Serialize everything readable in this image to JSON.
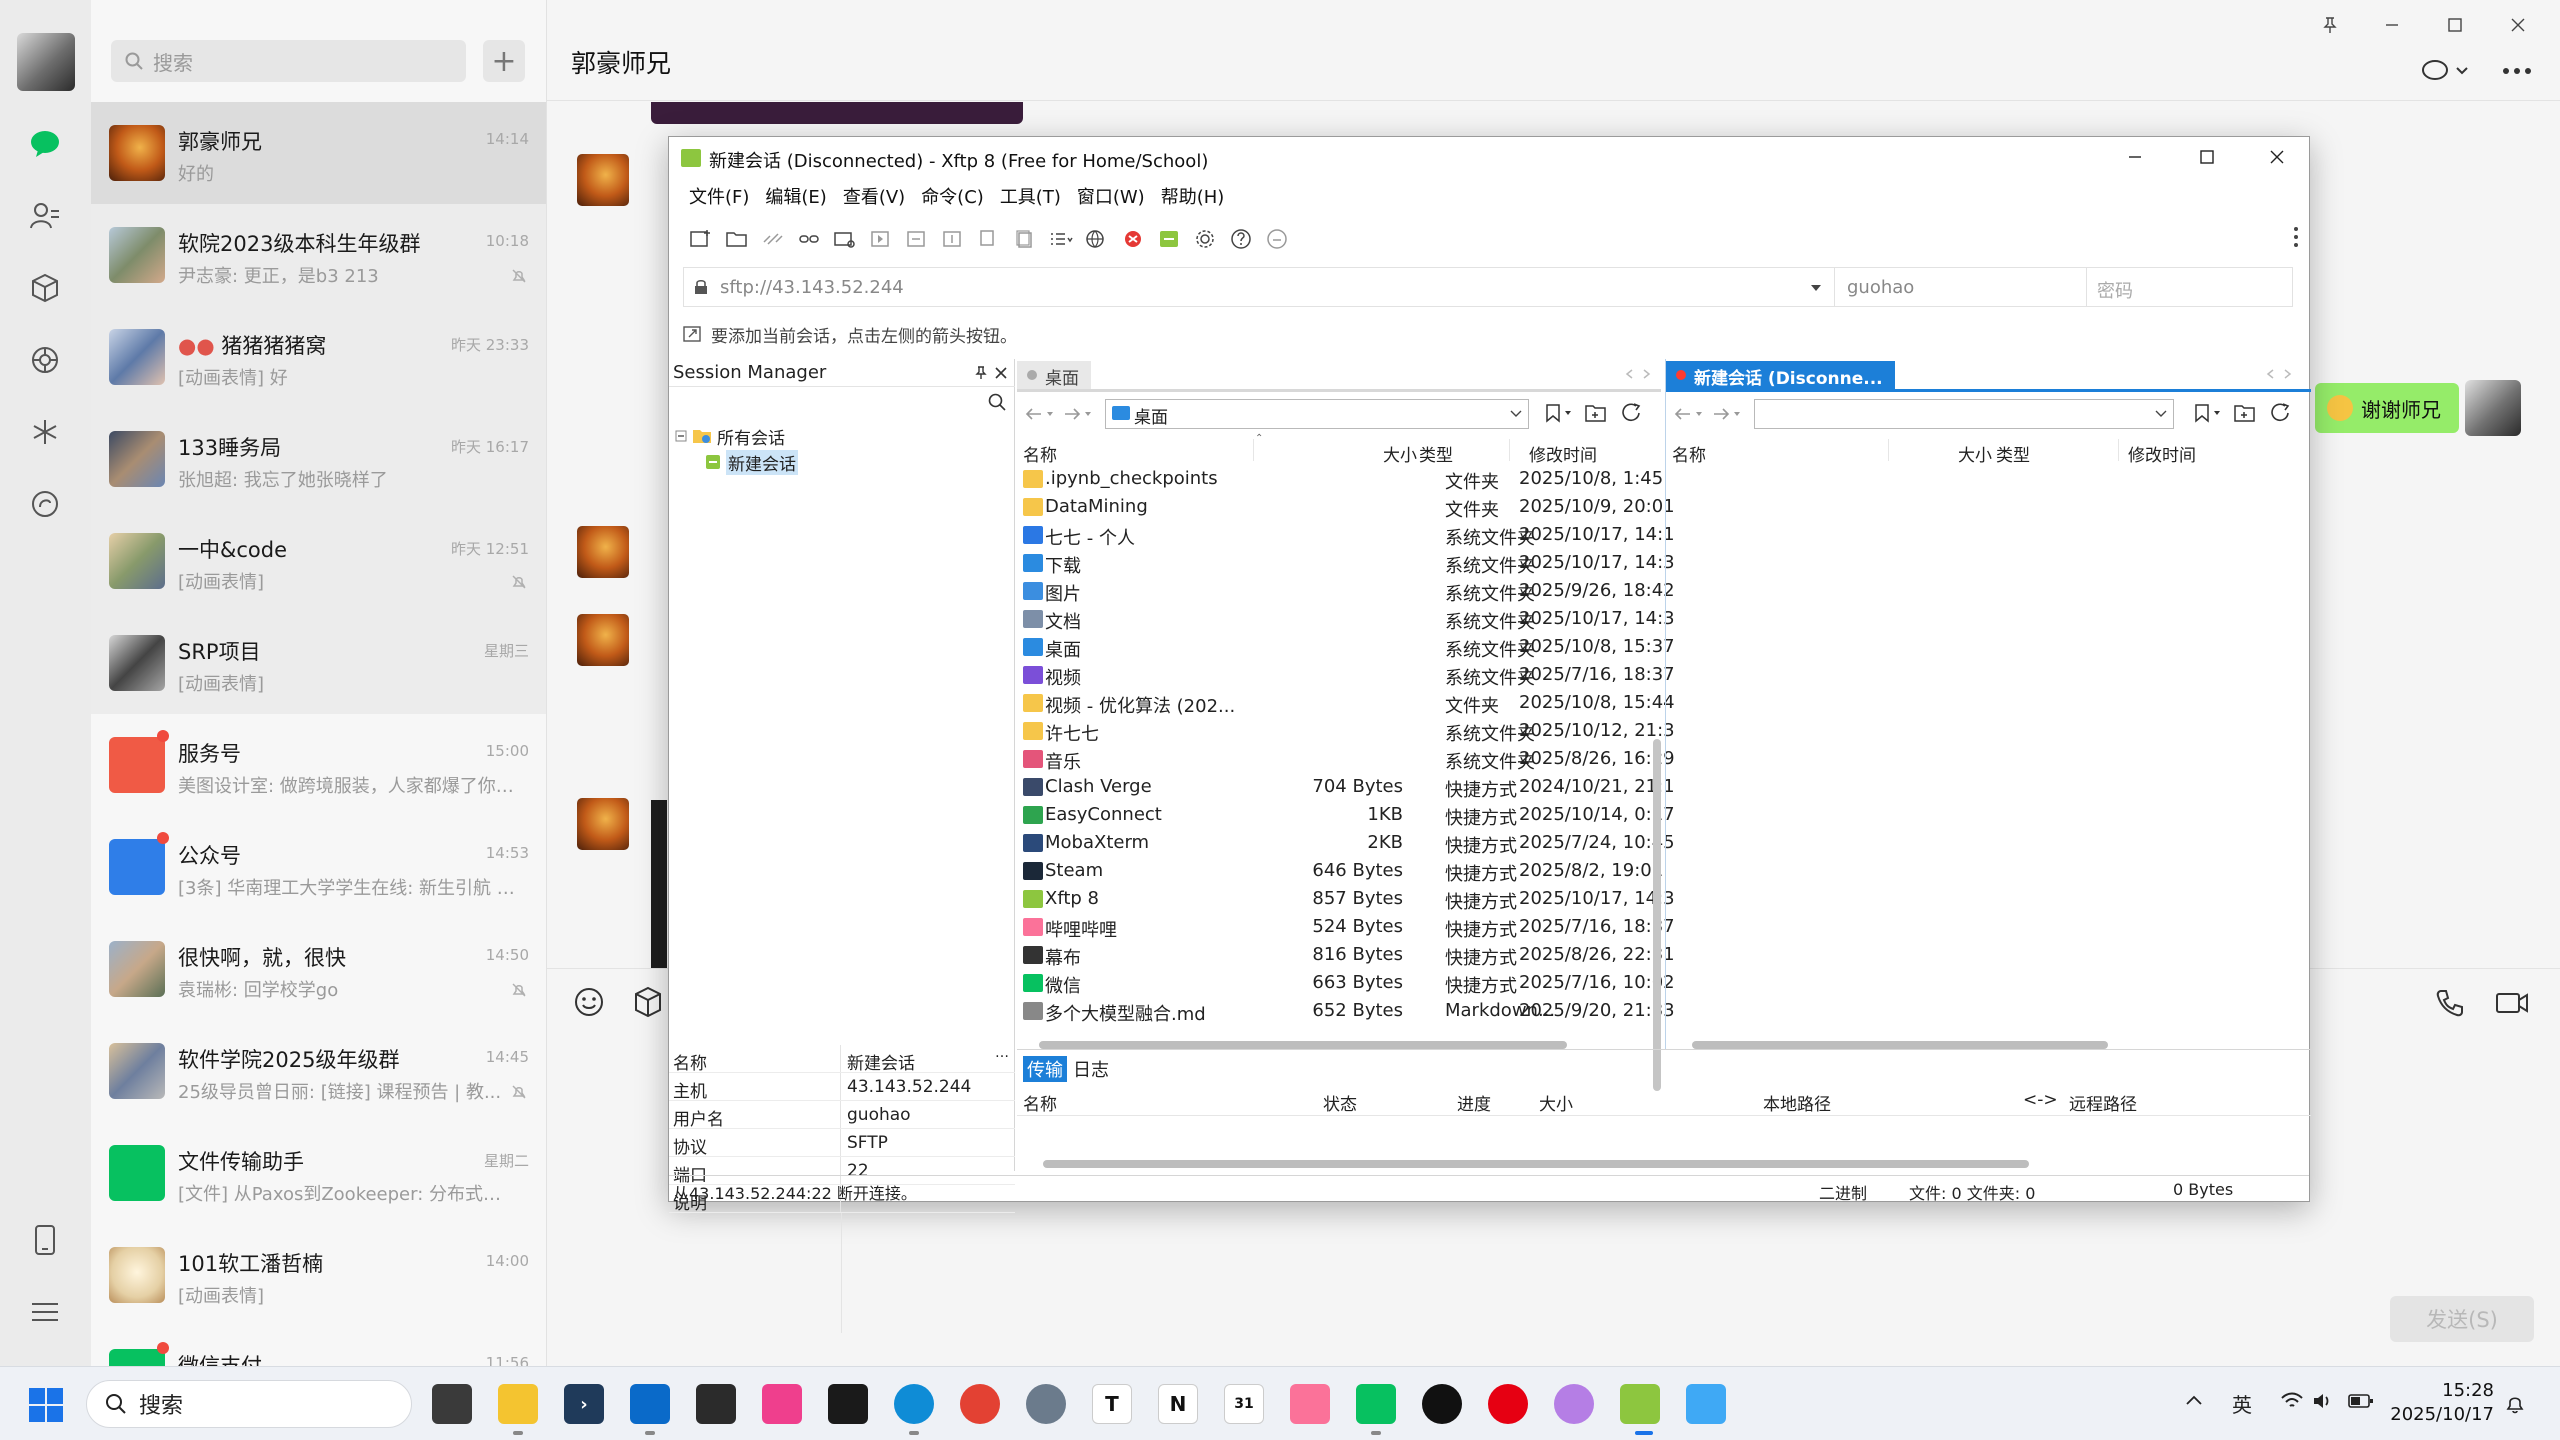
{
  "wechat": {
    "search_placeholder": "搜索",
    "add_label": "+",
    "chat_title": "郭豪师兄",
    "send_label": "发送(S)",
    "sent_bubble": "谢谢师兄",
    "chats": [
      {
        "name": "郭豪师兄",
        "preview": "好的",
        "time": "14:14",
        "selected": true
      },
      {
        "name": "软院2023级本科生年级群",
        "preview": "尹志豪: 更正，是b3 213",
        "time": "10:18",
        "muted": true
      },
      {
        "name": "猪猪猪猪窝",
        "preview": "[动画表情] 好",
        "time": "昨天 23:33"
      },
      {
        "name": "133睡务局",
        "preview": "张旭超: 我忘了她张晓样了",
        "time": "昨天 16:17"
      },
      {
        "name": "一中&code",
        "preview": "[动画表情]",
        "time": "昨天 12:51",
        "muted": true
      },
      {
        "name": "SRP项目",
        "preview": "[动画表情]",
        "time": "星期三"
      },
      {
        "name": "服务号",
        "preview": "美图设计室: 做跨境服装，人家都爆了你还...",
        "time": "15:00",
        "dot": true
      },
      {
        "name": "公众号",
        "preview": "[3条] 华南理工大学学生在线: 新生引航 | ...",
        "time": "14:53",
        "dot": true
      },
      {
        "name": "很快啊，就，很快",
        "preview": "袁瑞彬: 回学校学go",
        "time": "14:50",
        "muted": true
      },
      {
        "name": "软件学院2025级年级群",
        "preview": "25级导员曾日丽: [链接] 课程预告 | 教...",
        "time": "14:45",
        "muted": true
      },
      {
        "name": "文件传输助手",
        "preview": "[文件] 从Paxos到Zookeeper: 分布式一...",
        "time": "星期二"
      },
      {
        "name": "101软工潘哲楠",
        "preview": "[动画表情]",
        "time": "14:00"
      },
      {
        "name": "微信支付",
        "preview": "",
        "time": "11:56",
        "dot": true
      }
    ]
  },
  "xftp": {
    "title": "新建会话 (Disconnected) - Xftp 8 (Free for Home/School)",
    "menu": [
      "文件(F)",
      "编辑(E)",
      "查看(V)",
      "命令(C)",
      "工具(T)",
      "窗口(W)",
      "帮助(H)"
    ],
    "address": "sftp://43.143.52.244",
    "user_field": "guohao",
    "password_placeholder": "密码",
    "hint": "要添加当前会话，点击左侧的箭头按钮。",
    "session_manager": {
      "title": "Session Manager",
      "tree_root": "所有会话",
      "tree_child": "新建会话",
      "props": [
        {
          "k": "名称",
          "v": "新建会话"
        },
        {
          "k": "主机",
          "v": "43.143.52.244"
        },
        {
          "k": "用户名",
          "v": "guohao"
        },
        {
          "k": "协议",
          "v": "SFTP"
        },
        {
          "k": "端口",
          "v": "22"
        },
        {
          "k": "说明",
          "v": ""
        }
      ]
    },
    "left_pane": {
      "tab": "桌面",
      "path": "桌面",
      "columns": [
        "名称",
        "大小",
        "类型",
        "修改时间"
      ],
      "files": [
        {
          "name": ".ipynb_checkpoints",
          "size": "",
          "type": "文件夹",
          "mtime": "2025/10/8, 1:45",
          "icon": "folder"
        },
        {
          "name": "DataMining",
          "size": "",
          "type": "文件夹",
          "mtime": "2025/10/9, 20:01",
          "icon": "folder"
        },
        {
          "name": "七七 - 个人",
          "size": "",
          "type": "系统文件夹",
          "mtime": "2025/10/17, 14:1",
          "icon": "cloud"
        },
        {
          "name": "下载",
          "size": "",
          "type": "系统文件夹",
          "mtime": "2025/10/17, 14:3",
          "icon": "download"
        },
        {
          "name": "图片",
          "size": "",
          "type": "系统文件夹",
          "mtime": "2025/9/26, 18:42",
          "icon": "pictures"
        },
        {
          "name": "文档",
          "size": "",
          "type": "系统文件夹",
          "mtime": "2025/10/17, 14:3",
          "icon": "documents"
        },
        {
          "name": "桌面",
          "size": "",
          "type": "系统文件夹",
          "mtime": "2025/10/8, 15:37",
          "icon": "desktop"
        },
        {
          "name": "视频",
          "size": "",
          "type": "系统文件夹",
          "mtime": "2025/7/16, 18:37",
          "icon": "videos"
        },
        {
          "name": "视频 - 优化算法 (202...",
          "size": "",
          "type": "文件夹",
          "mtime": "2025/10/8, 15:44",
          "icon": "folder"
        },
        {
          "name": "许七七",
          "size": "",
          "type": "系统文件夹",
          "mtime": "2025/10/12, 21:3",
          "icon": "folder"
        },
        {
          "name": "音乐",
          "size": "",
          "type": "系统文件夹",
          "mtime": "2025/8/26, 16:29",
          "icon": "music"
        },
        {
          "name": "Clash Verge",
          "size": "704 Bytes",
          "type": "快捷方式",
          "mtime": "2024/10/21, 21:1",
          "icon": "clash"
        },
        {
          "name": "EasyConnect",
          "size": "1KB",
          "type": "快捷方式",
          "mtime": "2025/10/14, 0:17",
          "icon": "easyconnect"
        },
        {
          "name": "MobaXterm",
          "size": "2KB",
          "type": "快捷方式",
          "mtime": "2025/7/24, 10:45",
          "icon": "mobaxterm"
        },
        {
          "name": "Steam",
          "size": "646 Bytes",
          "type": "快捷方式",
          "mtime": "2025/8/2, 19:01",
          "icon": "steam"
        },
        {
          "name": "Xftp 8",
          "size": "857 Bytes",
          "type": "快捷方式",
          "mtime": "2025/10/17, 14:3",
          "icon": "xftp"
        },
        {
          "name": "哔哩哔哩",
          "size": "524 Bytes",
          "type": "快捷方式",
          "mtime": "2025/7/16, 18:37",
          "icon": "bilibili"
        },
        {
          "name": "幕布",
          "size": "816 Bytes",
          "type": "快捷方式",
          "mtime": "2025/8/26, 22:31",
          "icon": "mubu"
        },
        {
          "name": "微信",
          "size": "663 Bytes",
          "type": "快捷方式",
          "mtime": "2025/7/16, 10:02",
          "icon": "wechat"
        },
        {
          "name": "多个大模型融合.md",
          "size": "652 Bytes",
          "type": "Markdown...",
          "mtime": "2025/9/20, 21:33",
          "icon": "md"
        }
      ]
    },
    "right_pane": {
      "tab": "新建会话 (Disconne...",
      "columns": [
        "名称",
        "大小",
        "类型",
        "修改时间"
      ]
    },
    "transfer": {
      "tabs": [
        "传输",
        "日志"
      ],
      "columns": [
        "名称",
        "状态",
        "进度",
        "大小",
        "本地路径",
        "<->",
        "远程路径"
      ]
    },
    "status": {
      "left": "从43.143.52.244:22 断开连接。",
      "mode": "二进制",
      "files": "文件: 0  文件夹: 0",
      "bytes": "0 Bytes"
    }
  },
  "taskbar": {
    "search_label": "搜索",
    "ime": "英",
    "time": "15:28",
    "date": "2025/10/17"
  },
  "colors": {
    "wechat_green": "#07c160",
    "xftp_accent": "#1c7fd8",
    "bubble_green": "#95ec69"
  }
}
